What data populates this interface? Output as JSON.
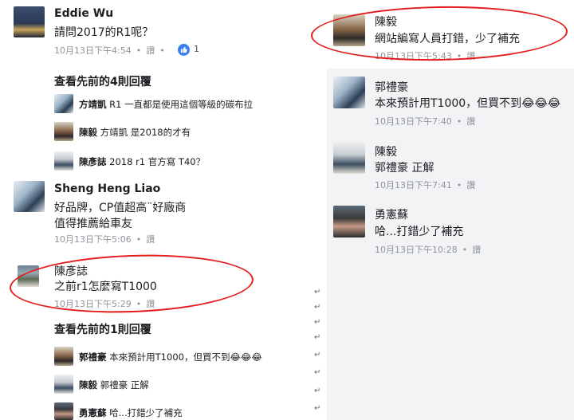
{
  "left": {
    "c1": {
      "name": "Eddie Wu",
      "text": "請問2017的R1呢？",
      "time": "10月13日下午4:54",
      "read": "讚",
      "likes": "1"
    },
    "more4": "查看先前的4則回覆",
    "r1": {
      "name": "方靖凱",
      "text": "R1 一直都是使用這個等級的碳布拉"
    },
    "r2": {
      "name": "陳毅",
      "text": "方靖凱 是2018的才有"
    },
    "r3": {
      "name": "陳彥誌",
      "text": "2018 r1 官方寫 T40？"
    },
    "c2": {
      "name": "Sheng Heng Liao",
      "line1": "好品牌，CP值超高¨好廠商",
      "line2": "值得推薦給車友",
      "time": "10月13日下午5:06",
      "read": "讚"
    },
    "c3": {
      "name": "陳彥誌",
      "text": "之前r1怎麼寫T1000",
      "time": "10月13日下午5:29",
      "read": "讚"
    },
    "more1": "查看先前的1則回覆",
    "r4": {
      "name": "郭禮豪",
      "text": "本來預計用T1000，但買不到😂😂😂"
    },
    "r5": {
      "name": "陳毅",
      "text": "郭禮豪 正解"
    },
    "r6": {
      "name": "勇憲蘇",
      "text": "哈...打錯少了補充"
    }
  },
  "right": {
    "c1": {
      "name": "陳毅",
      "text": "網站編寫人員打錯，少了補充",
      "time": "10月13日下午5:43",
      "read": "讚"
    },
    "c2": {
      "name": "郭禮豪",
      "text": "本來預計用T1000，但買不到😂😂😂",
      "time": "10月13日下午7:40",
      "read": "讚"
    },
    "c3": {
      "name": "陳毅",
      "mention": "郭禮豪",
      "text": "正解",
      "time": "10月13日下午7:41",
      "read": "讚"
    },
    "c4": {
      "name": "勇憲蘇",
      "text": "哈...打錯少了補充",
      "time": "10月13日下午10:28",
      "read": "讚"
    }
  },
  "return_mark": "↵",
  "colors": {
    "link": "#1c1e21",
    "meta": "#90949c",
    "like": "#3b7ff5",
    "highlight": "#e31c1c",
    "panel": "#f2f3f5"
  }
}
